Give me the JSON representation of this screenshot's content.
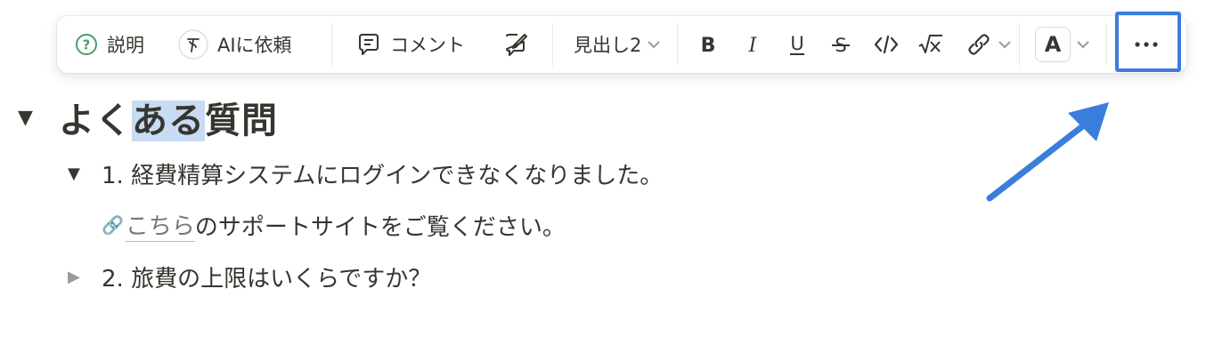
{
  "toolbar": {
    "explain_label": "説明",
    "ai_label": "AIに依頼",
    "comment_label": "コメント",
    "block_type_label": "見出し2",
    "text_color_label": "A"
  },
  "icons": {
    "explain": "question-circle-icon",
    "ai": "ai-sparkle-icon",
    "comment": "comment-bubble-icon",
    "edit": "edit-suggest-icon",
    "bold": "bold-icon",
    "italic": "italic-icon",
    "underline": "underline-icon",
    "strike": "strikethrough-icon",
    "code": "code-icon",
    "equation": "equation-icon",
    "link": "link-icon",
    "more": "more-horizontal-icon",
    "link_emoji": "🔗"
  },
  "heading": {
    "pre": "よく",
    "selected": "ある",
    "post": "質問"
  },
  "items": [
    {
      "text": "1. 経費精算システムにログインできなくなりました。",
      "expanded": true
    },
    {
      "text": "2. 旅費の上限はいくらですか？",
      "expanded": false
    }
  ],
  "answer": {
    "link_text": "こちら",
    "rest": "のサポートサイトをご覧ください。"
  },
  "colors": {
    "accent_frame": "#3b7ddd",
    "selection": "#c8dbf2",
    "text": "#37352f"
  }
}
